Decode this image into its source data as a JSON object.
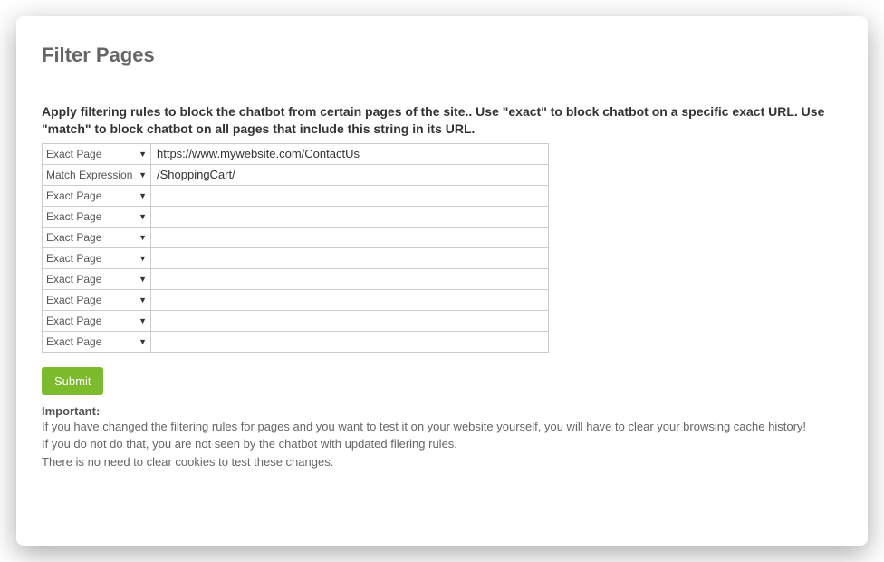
{
  "page": {
    "title": "Filter Pages",
    "instructions": "Apply filtering rules to block the chatbot from certain pages of the site.. Use \"exact\" to block chatbot on a specific exact URL. Use \"match\" to block chatbot on all pages that include this string in its URL."
  },
  "select_options": {
    "exact": "Exact Page",
    "match": "Match Expression"
  },
  "rows": [
    {
      "type_label": "Exact Page",
      "value": "https://www.mywebsite.com/ContactUs"
    },
    {
      "type_label": "Match Expression",
      "value": "/ShoppingCart/"
    },
    {
      "type_label": "Exact Page",
      "value": ""
    },
    {
      "type_label": "Exact Page",
      "value": ""
    },
    {
      "type_label": "Exact Page",
      "value": ""
    },
    {
      "type_label": "Exact Page",
      "value": ""
    },
    {
      "type_label": "Exact Page",
      "value": ""
    },
    {
      "type_label": "Exact Page",
      "value": ""
    },
    {
      "type_label": "Exact Page",
      "value": ""
    },
    {
      "type_label": "Exact Page",
      "value": ""
    }
  ],
  "submit_label": "Submit",
  "notes": {
    "heading": "Important:",
    "line1": "If you have changed the filtering rules for pages and you want to test it on your website yourself, you will have to clear your browsing cache history!",
    "line2": "If you do not do that, you are not seen by the chatbot with updated filering rules.",
    "line3": "There is no need to clear cookies to test these changes."
  }
}
